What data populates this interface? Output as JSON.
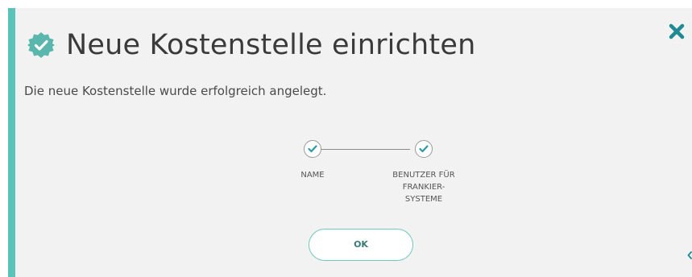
{
  "dialog": {
    "title": "Neue Kostenstelle einrichten",
    "message": "Die neue Kostenstelle wurde erfolgreich angelegt.",
    "title_icon": "verified-badge-icon",
    "close_icon": "close-icon",
    "steps": [
      {
        "label": "NAME",
        "status": "completed",
        "icon": "check-icon"
      },
      {
        "label_lines": [
          "BENUTZER FÜR",
          "FRANKIER-",
          "SYSTEME"
        ],
        "status": "completed",
        "icon": "check-icon"
      }
    ],
    "ok_label": "OK"
  },
  "colors": {
    "accent": "#5bc3ba",
    "close": "#1f8a94",
    "check": "#2a9aa6",
    "background": "#f2f2f2",
    "title_text": "#3a3a3a"
  }
}
